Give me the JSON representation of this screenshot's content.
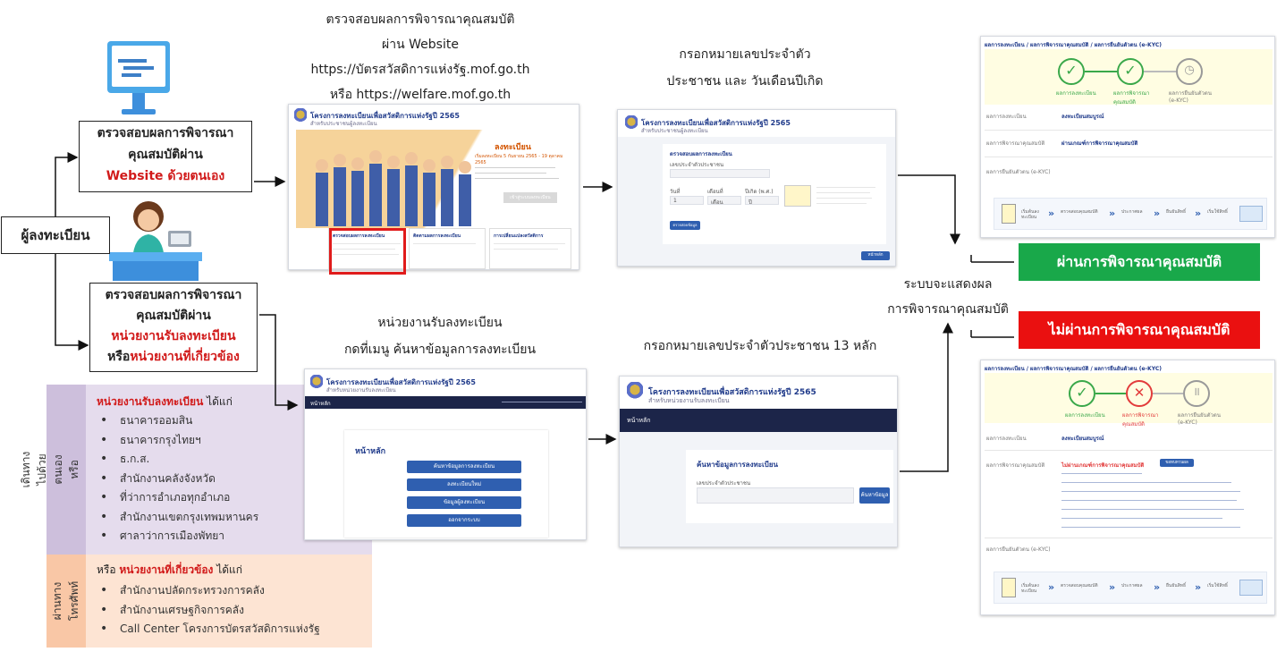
{
  "headings": {
    "website_check": [
      "ตรวจสอบผลการพิจารณาคุณสมบัติ",
      "ผ่าน Website",
      "https://บัตรสวัสดิการแห่งรัฐ.mof.go.th",
      "หรือ https://welfare.mof.go.th"
    ],
    "enter_id": [
      "กรอกหมายเลขประจำตัว",
      "ประชาชน และ วันเดือนปีเกิด"
    ],
    "agency_menu": [
      "หน่วยงานรับลงทะเบียน",
      "กดที่เมนู ค้นหาข้อมูลการลงทะเบียน"
    ],
    "enter_id_13": "กรอกหมายเลขประจำตัวประชาชน 13 หลัก",
    "system_show": [
      "ระบบจะแสดงผล",
      "การพิจารณาคุณสมบัติ"
    ]
  },
  "registrant_label": "ผู้ลงทะเบียน",
  "box_self": {
    "line1": "ตรวจสอบผลการพิจารณา",
    "line2": "คุณสมบัติผ่าน",
    "line3": "Website ด้วยตนเอง"
  },
  "box_agency": {
    "line1": "ตรวจสอบผลการพิจารณา",
    "line2": "คุณสมบัติผ่าน",
    "line3": "หน่วยงานรับลงทะเบียน",
    "line4_prefix": "หรือ",
    "line4_red": "หน่วยงานที่เกี่ยวข้อง"
  },
  "result_pass": "ผ่านการพิจารณาคุณสมบัติ",
  "result_fail": "ไม่ผ่านการพิจารณาคุณสมบัติ",
  "in_person": {
    "side_label": "เดินทางไปด้วยตนเอง หรือมอบอำนาจ",
    "heading_red": "หน่วยงานรับลงทะเบียน",
    "heading_suffix": " ได้แก่",
    "items": [
      "ธนาคารออมสิน",
      "ธนาคารกรุงไทยฯ",
      "ธ.ก.ส.",
      "สำนักงานคลังจังหวัด",
      "ที่ว่าการอำเภอทุกอำเภอ",
      "สำนักงานเขตกรุงเทพมหานคร",
      "ศาลาว่าการเมืองพัทยา"
    ]
  },
  "phone": {
    "side_label": "ผ่านทางโทรศัพท์",
    "heading_prefix": "หรือ ",
    "heading_red": "หน่วยงานที่เกี่ยวข้อง",
    "heading_suffix": " ได้แก่",
    "items": [
      "สำนักงานปลัดกระทรวงการคลัง",
      "สำนักงานเศรษฐกิจการคลัง",
      "Call Center โครงการบัตรสวัสดิการแห่งรัฐ"
    ]
  },
  "thumbs": {
    "project_title": "โครงการลงทะเบียนเพื่อสวัสดิการแห่งรัฐปี 2565",
    "public_sub": "สำหรับประชาชนผู้ลงทะเบียน",
    "agency_sub": "สำหรับหน่วยงานรับลงทะเบียน",
    "register_title": "ลงทะเบียน",
    "register_dates": "เริ่มลงทะเบียน 5 กันยายน 2565 - 19 ตุลาคม 2565",
    "register_btn": "เข้าสู่ระบบลงทะเบียน",
    "cards": [
      "ตรวจสอบผลการลงทะเบียน",
      "ติดตามผลการลงทะเบียน",
      "การเปลี่ยนแปลงสวัสดิการ"
    ],
    "check_heading": "ตรวจสอบผลการลงทะเบียน",
    "id_label": "เลขประจำตัวประชาชน",
    "dob_labels": [
      "วันที่",
      "เดือนที่",
      "ปีเกิด (พ.ศ.)"
    ],
    "dob_values": [
      "1",
      "เดือน",
      "ปี"
    ],
    "check_btn": "ตรวจสอบข้อมูล",
    "home_btn": "หน้าหลัก",
    "home_nav": "หน้าหลัก",
    "home_page": "หน้าหลัก",
    "menu_buttons": [
      "ค้นหาข้อมูลการลงทะเบียน",
      "ลงทะเบียนใหม่",
      "ข้อมูลผู้ลงทะเบียน",
      "ออกจากระบบ"
    ],
    "search_heading": "ค้นหาข้อมูลการลงทะเบียน",
    "search_label": "เลขประจำตัวประชาชน",
    "search_btn": "ค้นหาข้อมูล",
    "breadcrumb": "ผลการลงทะเบียน / ผลการพิจารณาคุณสมบัติ / ผลการยืนยันตัวตน (e-KYC)",
    "steps": [
      "ผลการลงทะเบียน",
      "ผลการพิจารณาคุณสมบัติ",
      "ผลการยืนยันตัวตน (e-KYC)"
    ],
    "rows": [
      "ผลการลงทะเบียน",
      "ผลการพิจารณาคุณสมบัติ",
      "ผลการยืนยันตัวตน (e-KYC)"
    ],
    "row_values": [
      "ลงทะเบียนสมบูรณ์",
      "ผ่านเกณฑ์การพิจารณาคุณสมบัติ"
    ],
    "fail_value": "ไม่ผ่านเกณฑ์การพิจารณาคุณสมบัติ",
    "fail_btn": "ขอทบทวนผล",
    "flow": [
      "เริ่มต้นลงทะเบียน",
      "ตรวจสอบคุณสมบัติ",
      "ประกาศผล",
      "ยืนยันสิทธิ์",
      "เริ่มใช้สิทธิ์"
    ]
  },
  "colors": {
    "pass_green": "#19a84a",
    "fail_red": "#ea1010",
    "accent_red": "#d11a1a",
    "purple_panel": "#e5dced",
    "peach_panel": "#fde4d3"
  }
}
